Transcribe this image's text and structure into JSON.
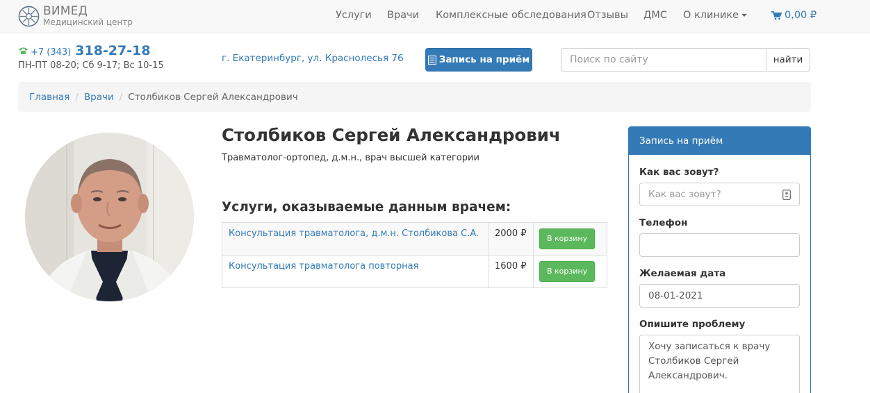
{
  "brand": {
    "name": "ВИМЕД",
    "subtitle": "Медицинский центр"
  },
  "nav": {
    "items": [
      "Услуги",
      "Врачи",
      "Комплексные обследования",
      "Отзывы",
      "ДМС"
    ],
    "dropdown_label": "О клинике",
    "cart_total": "0,00 ₽"
  },
  "contacts": {
    "phone_prefix": "+7 (343)",
    "phone_number": "318-27-18",
    "hours": "ПН-ПТ 08-20; Сб 9-17; Вс 10-15",
    "address": "г. Екатеринбург, ул. Краснолесья 76"
  },
  "appointment_button": "Запись на приём",
  "search": {
    "placeholder": "Поиск по сайту",
    "button": "найти"
  },
  "breadcrumb": {
    "home": "Главная",
    "section": "Врачи",
    "current": "Столбиков Сергей Александрович"
  },
  "doctor": {
    "name": "Столбиков Сергей Александрович",
    "title": "Травматолог-ортопед, д.м.н., врач высшей категории"
  },
  "services": {
    "heading": "Услуги, оказываемые данным врачем:",
    "add_label": "В корзину",
    "rows": [
      {
        "name": "Консультация травматолога, д.м.н. Столбикова С.А.",
        "price": "2000 ₽"
      },
      {
        "name": "Консультация травматолога повторная",
        "price": "1600 ₽"
      }
    ]
  },
  "form": {
    "heading": "Запись на приём",
    "name_label": "Как вас зовут?",
    "name_placeholder": "Как вас зовут?",
    "phone_label": "Телефон",
    "phone_value": "",
    "date_label": "Желаемая дата",
    "date_value": "08-01-2021",
    "problem_label": "Опишите проблему",
    "problem_value": "Хочу записаться к врачу Столбиков Сергей Александрович."
  },
  "colors": {
    "primary": "#337ab7",
    "success": "#5cb85c",
    "navbar_bg": "#f8f8f8",
    "breadcrumb_bg": "#f5f5f5"
  },
  "icons": [
    "vimed-logo-icon",
    "phone-icon",
    "cart-icon",
    "list-icon",
    "contact-card-icon"
  ]
}
